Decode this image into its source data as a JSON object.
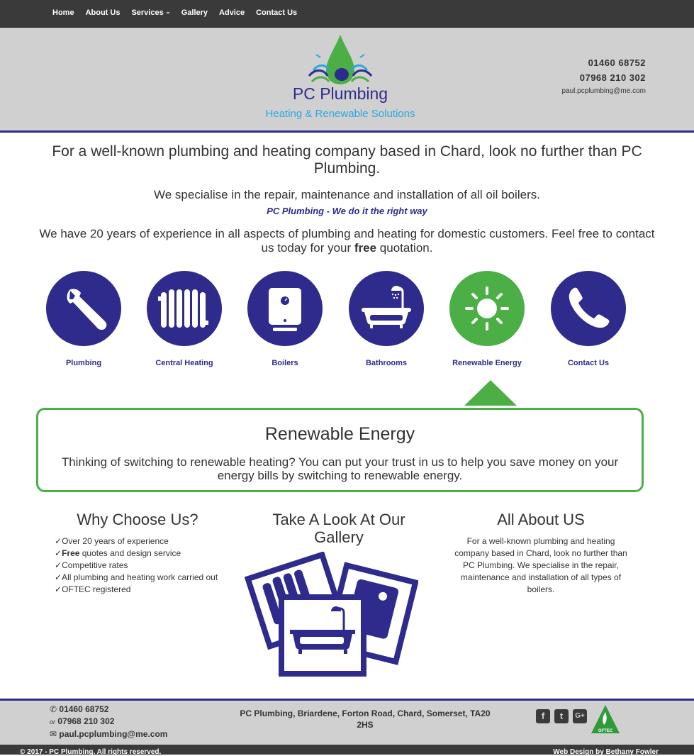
{
  "nav": {
    "items": [
      {
        "label": "Home"
      },
      {
        "label": "About Us"
      },
      {
        "label": "Services"
      },
      {
        "label": "Gallery"
      },
      {
        "label": "Advice"
      },
      {
        "label": "Contact Us"
      }
    ]
  },
  "header": {
    "logo_title": "PC Plumbing",
    "logo_subtitle": "Heating & Renewable Solutions",
    "phone1": "01460 68752",
    "phone2": "07968 210 302",
    "email": "paul.pcplumbing@me.com"
  },
  "intro": {
    "lead": "For a well-known plumbing and heating company based in Chard, look no further than PC Plumbing.",
    "specialise": "We specialise in the repair, maintenance and installation of all oil boilers.",
    "tagline": "PC Plumbing - We do it the right way",
    "experience_pre": "We have 20 years of experience in all aspects of plumbing and heating for domestic customers. Feel free to contact us today for your ",
    "experience_bold": "free",
    "experience_post": " quotation."
  },
  "services": [
    {
      "label": "Plumbing",
      "icon": "wrench-icon"
    },
    {
      "label": "Central Heating",
      "icon": "radiator-icon"
    },
    {
      "label": "Boilers",
      "icon": "boiler-icon"
    },
    {
      "label": "Bathrooms",
      "icon": "bathtub-icon"
    },
    {
      "label": "Renewable Energy",
      "icon": "sun-icon",
      "active": true
    },
    {
      "label": "Contact Us",
      "icon": "phone-icon"
    }
  ],
  "panel": {
    "title": "Renewable Energy",
    "text": "Thinking of switching to renewable heating? You can put your trust in us to help you save money on your energy bills by switching to renewable energy."
  },
  "why": {
    "title": "Why Choose Us?",
    "items": [
      {
        "text": "Over 20 years of experience"
      },
      {
        "bold": "Free",
        "text": " quotes and design service"
      },
      {
        "text": "Competitive rates"
      },
      {
        "text": "All plumbing and heating work carried out"
      },
      {
        "text": "OFTEC registered"
      }
    ]
  },
  "gallery": {
    "title": "Take A Look At Our Gallery"
  },
  "about": {
    "title": "All About US",
    "text": "For a well-known plumbing and heating company based in Chard, look no further than PC Plumbing. We specialise in the repair, maintenance and installation of all types of boilers."
  },
  "footer": {
    "phone1": "01460 68752",
    "or": "or",
    "phone2": "07968 210 302",
    "email": "paul.pcplumbing@me.com",
    "address": "PC Plumbing, Briardene, Forton Road, Chard, Somerset, TA20 2HS",
    "oftec_label": "OFTEC",
    "copyright": "© 2017 - PC Plumbing. All rights reserved.",
    "credit": "Web Design by Bethany Fowler"
  },
  "colors": {
    "brand": "#2e2b8c",
    "accent": "#4caf46",
    "light_blue": "#29a8e0",
    "nav_bg": "#3a3a3a",
    "header_bg": "#d0d0d0"
  }
}
